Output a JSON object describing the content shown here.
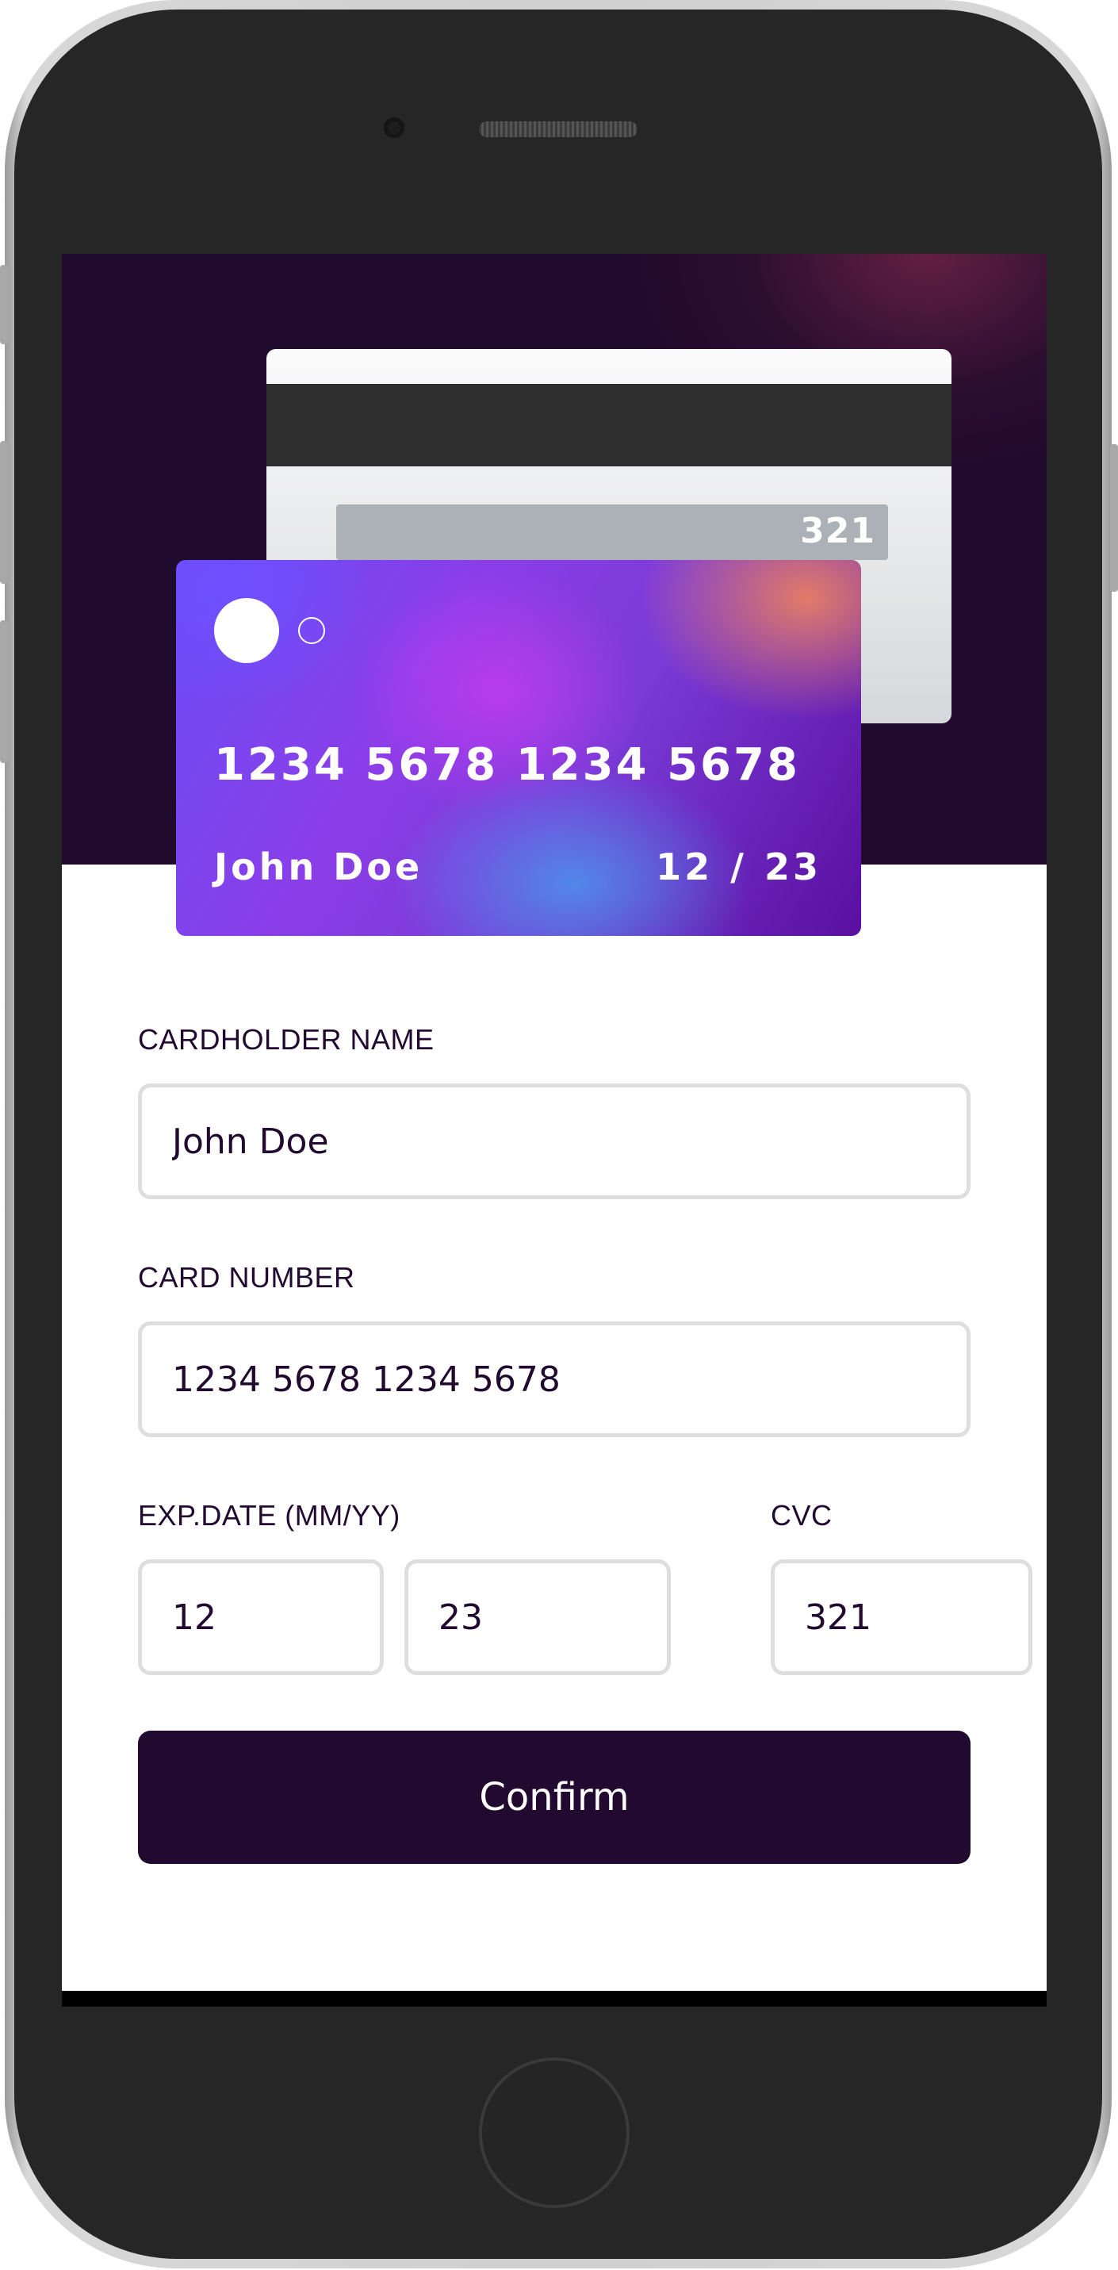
{
  "card_preview": {
    "back_cvc": "321",
    "number": "1234 5678 1234 5678",
    "name": "John Doe",
    "exp_month": "12",
    "exp_separator": "/",
    "exp_year": "23"
  },
  "form": {
    "cardholder_label": "CARDHOLDER NAME",
    "cardholder_value": "John Doe",
    "card_number_label": "CARD NUMBER",
    "card_number_value": "1234 5678 1234 5678",
    "exp_label": "EXP.DATE (MM/YY)",
    "exp_month_value": "12",
    "exp_year_value": "23",
    "cvc_label": "CVC",
    "cvc_value": "321",
    "confirm_label": "Confirm"
  },
  "colors": {
    "primary": "#21092f",
    "field_border": "#dedede",
    "hero_background": "#200a2e"
  }
}
